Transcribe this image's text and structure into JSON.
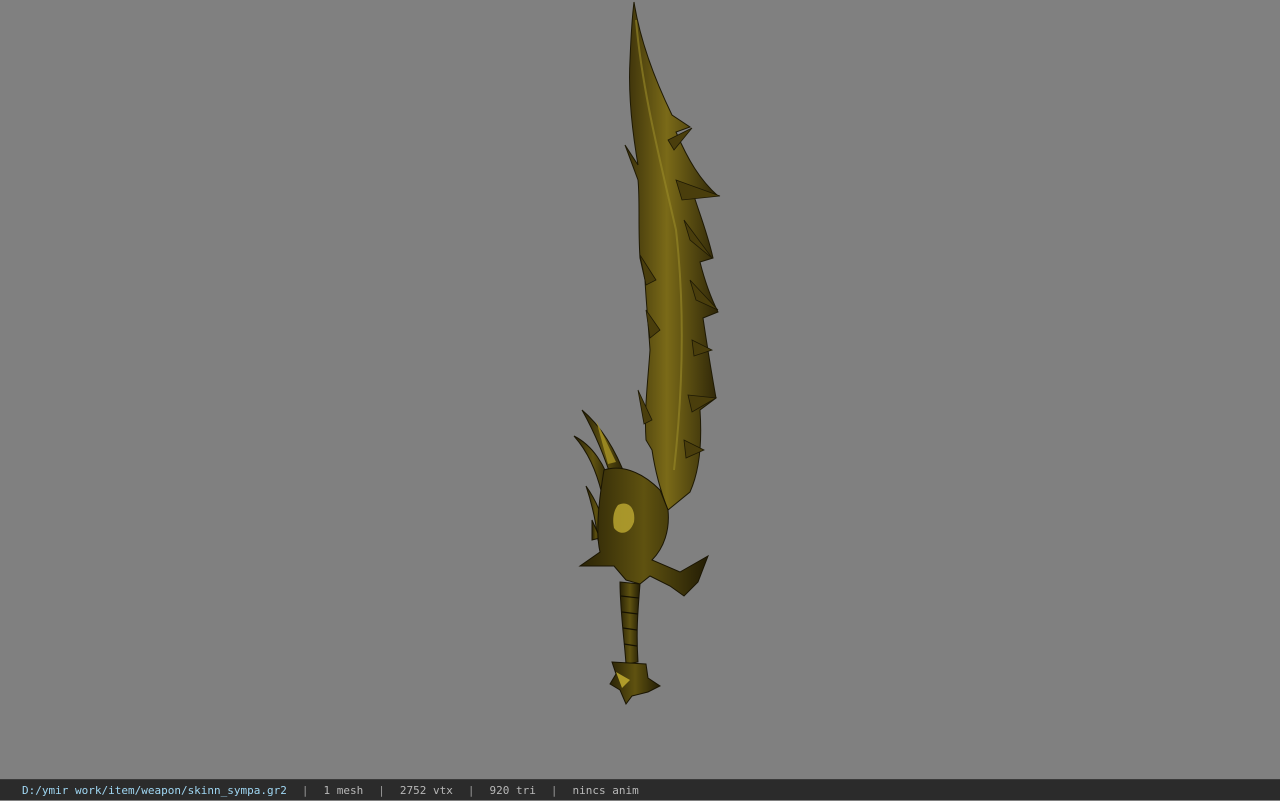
{
  "viewer": {
    "background_color": "#808080",
    "model_color": "#6b5a12"
  },
  "statusbar": {
    "file_path": "D:/ymir work/item/weapon/skinn_sympa.gr2",
    "separator": "|",
    "mesh_count": "1 mesh",
    "vertex_count": "2752 vtx",
    "triangle_count": "920 tri",
    "animation": "nincs anim"
  }
}
